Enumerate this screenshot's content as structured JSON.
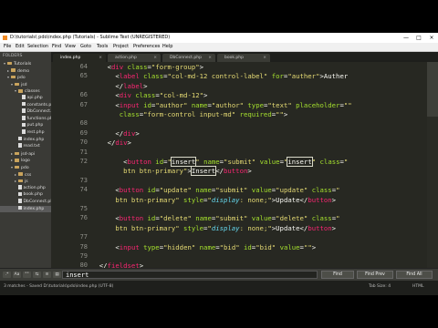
{
  "window": {
    "title": "D:\\tutorials\\ pdo\\index.php (Tutorials) - Sublime Text (UNREGISTERED)",
    "min_glyph": "—",
    "max_glyph": "□",
    "close_glyph": "×"
  },
  "menu": [
    "File",
    "Edit",
    "Selection",
    "Find",
    "View",
    "Goto",
    "Tools",
    "Project",
    "Preferences",
    "Help"
  ],
  "sidebar": {
    "header": "FOLDERS",
    "items": [
      {
        "label": "Tutorials",
        "kind": "folder",
        "twisty": "▾",
        "indent": 1
      },
      {
        "label": "demo",
        "kind": "folder",
        "twisty": "▸",
        "indent": 2
      },
      {
        "label": "pdo",
        "kind": "folder",
        "twisty": "▾",
        "indent": 2
      },
      {
        "label": "jsd",
        "kind": "folder",
        "twisty": "▾",
        "indent": 3
      },
      {
        "label": "classes",
        "kind": "folder",
        "twisty": "▾",
        "indent": 4
      },
      {
        "label": "api.php",
        "kind": "file",
        "twisty": "",
        "indent": 5
      },
      {
        "label": "constants.php",
        "kind": "file",
        "twisty": "",
        "indent": 5
      },
      {
        "label": "DbConnect.php",
        "kind": "file",
        "twisty": "",
        "indent": 5
      },
      {
        "label": "functions.php",
        "kind": "file",
        "twisty": "",
        "indent": 5
      },
      {
        "label": "put.php",
        "kind": "file",
        "twisty": "",
        "indent": 5
      },
      {
        "label": "rest.php",
        "kind": "file",
        "twisty": "",
        "indent": 5
      },
      {
        "label": "index.php",
        "kind": "file",
        "twisty": "",
        "indent": 4
      },
      {
        "label": "read.txt",
        "kind": "file",
        "twisty": "",
        "indent": 4
      },
      {
        "label": "jsd-api",
        "kind": "folder",
        "twisty": "▸",
        "indent": 3
      },
      {
        "label": "logo",
        "kind": "folder",
        "twisty": "▸",
        "indent": 3
      },
      {
        "label": "pdo",
        "kind": "folder",
        "twisty": "▾",
        "indent": 3
      },
      {
        "label": "css",
        "kind": "folder",
        "twisty": "▸",
        "indent": 4
      },
      {
        "label": "js",
        "kind": "folder",
        "twisty": "▸",
        "indent": 4
      },
      {
        "label": "action.php",
        "kind": "file",
        "twisty": "",
        "indent": 4
      },
      {
        "label": "book.php",
        "kind": "file",
        "twisty": "",
        "indent": 4
      },
      {
        "label": "DbConnect.php",
        "kind": "file",
        "twisty": "",
        "indent": 4
      },
      {
        "label": "index.php",
        "kind": "file",
        "twisty": "",
        "indent": 4,
        "selected": true
      }
    ]
  },
  "tabs": [
    {
      "label": "index.php",
      "active": true
    },
    {
      "label": "action.php",
      "active": false
    },
    {
      "label": "DbConnect.php",
      "active": false
    },
    {
      "label": "book.php",
      "active": false
    }
  ],
  "tab_close_glyph": "×",
  "editor": {
    "lines": [
      {
        "num": "64",
        "tokens": [
          [
            "pn",
            "    <"
          ],
          [
            "tg",
            "div"
          ],
          [
            "at",
            " class"
          ],
          [
            "pn",
            "="
          ],
          [
            "st",
            "\"form-group\""
          ],
          [
            "pn",
            ">"
          ]
        ]
      },
      {
        "num": "65",
        "tokens": [
          [
            "pn",
            "      <"
          ],
          [
            "tg",
            "label"
          ],
          [
            "at",
            " class"
          ],
          [
            "pn",
            "="
          ],
          [
            "st",
            "\"col-md-12 control-label\""
          ],
          [
            "at",
            " for"
          ],
          [
            "pn",
            "="
          ],
          [
            "st",
            "\"auther\""
          ],
          [
            "pn",
            ">"
          ],
          [
            "tx",
            "Auther"
          ]
        ]
      },
      {
        "num": "",
        "tokens": [
          [
            "pn",
            "      </"
          ],
          [
            "tg",
            "label"
          ],
          [
            "pn",
            ">"
          ]
        ]
      },
      {
        "num": "66",
        "tokens": [
          [
            "pn",
            "      <"
          ],
          [
            "tg",
            "div"
          ],
          [
            "at",
            " class"
          ],
          [
            "pn",
            "="
          ],
          [
            "st",
            "\"col-md-12\""
          ],
          [
            "pn",
            ">"
          ]
        ]
      },
      {
        "num": "67",
        "tokens": [
          [
            "pn",
            "      <"
          ],
          [
            "tg",
            "input"
          ],
          [
            "at",
            " id"
          ],
          [
            "pn",
            "="
          ],
          [
            "st",
            "\"author\""
          ],
          [
            "at",
            " name"
          ],
          [
            "pn",
            "="
          ],
          [
            "st",
            "\"author\""
          ],
          [
            "at",
            " type"
          ],
          [
            "pn",
            "="
          ],
          [
            "st",
            "\"text\""
          ],
          [
            "at",
            " placeholder"
          ],
          [
            "pn",
            "="
          ],
          [
            "st",
            "\"\""
          ]
        ]
      },
      {
        "num": "",
        "tokens": [
          [
            "at",
            "       class"
          ],
          [
            "pn",
            "="
          ],
          [
            "st",
            "\"form-control input-md\""
          ],
          [
            "at",
            " required"
          ],
          [
            "pn",
            "="
          ],
          [
            "st",
            "\"\""
          ],
          [
            "pn",
            ">"
          ]
        ]
      },
      {
        "num": "68",
        "tokens": [
          [
            "pn",
            ""
          ]
        ]
      },
      {
        "num": "69",
        "tokens": [
          [
            "pn",
            "      </"
          ],
          [
            "tg",
            "div"
          ],
          [
            "pn",
            ">"
          ]
        ]
      },
      {
        "num": "70",
        "tokens": [
          [
            "pn",
            "    </"
          ],
          [
            "tg",
            "div"
          ],
          [
            "pn",
            ">"
          ]
        ]
      },
      {
        "num": "71",
        "tokens": [
          [
            "pn",
            ""
          ]
        ]
      },
      {
        "num": "72",
        "tokens": [
          [
            "pn",
            "        <"
          ],
          [
            "tg",
            "button"
          ],
          [
            "at",
            " id"
          ],
          [
            "pn",
            "="
          ],
          [
            "st",
            "\""
          ],
          [
            "hl",
            "insert"
          ],
          [
            "st",
            "\""
          ],
          [
            "at",
            " name"
          ],
          [
            "pn",
            "="
          ],
          [
            "st",
            "\"submit\""
          ],
          [
            "at",
            " value"
          ],
          [
            "pn",
            "="
          ],
          [
            "st",
            "\""
          ],
          [
            "hl",
            "insert"
          ],
          [
            "st",
            "\""
          ],
          [
            "at",
            " class"
          ],
          [
            "pn",
            "="
          ],
          [
            "st",
            "\""
          ]
        ]
      },
      {
        "num": "",
        "tokens": [
          [
            "st",
            "        btn btn-primary\""
          ],
          [
            "pn",
            ">"
          ],
          [
            "hl",
            "Insert"
          ],
          [
            "pn",
            "</"
          ],
          [
            "tg",
            "button"
          ],
          [
            "pn",
            ">"
          ]
        ]
      },
      {
        "num": "73",
        "tokens": [
          [
            "pn",
            ""
          ]
        ]
      },
      {
        "num": "74",
        "tokens": [
          [
            "pn",
            "      <"
          ],
          [
            "tg",
            "button"
          ],
          [
            "at",
            " id"
          ],
          [
            "pn",
            "="
          ],
          [
            "st",
            "\"update\""
          ],
          [
            "at",
            " name"
          ],
          [
            "pn",
            "="
          ],
          [
            "st",
            "\"submit\""
          ],
          [
            "at",
            " value"
          ],
          [
            "pn",
            "="
          ],
          [
            "st",
            "\"update\""
          ],
          [
            "at",
            " class"
          ],
          [
            "pn",
            "="
          ],
          [
            "st",
            "\""
          ]
        ]
      },
      {
        "num": "",
        "tokens": [
          [
            "st",
            "      btn btn-primary\""
          ],
          [
            "at",
            " style"
          ],
          [
            "pn",
            "="
          ],
          [
            "st",
            "\""
          ],
          [
            "ki",
            "display"
          ],
          [
            "st",
            ": none;\""
          ],
          [
            "pn",
            ">"
          ],
          [
            "tx",
            "Update"
          ],
          [
            "pn",
            "</"
          ],
          [
            "tg",
            "button"
          ],
          [
            "pn",
            ">"
          ]
        ]
      },
      {
        "num": "75",
        "tokens": [
          [
            "pn",
            ""
          ]
        ]
      },
      {
        "num": "76",
        "tokens": [
          [
            "pn",
            "      <"
          ],
          [
            "tg",
            "button"
          ],
          [
            "at",
            " id"
          ],
          [
            "pn",
            "="
          ],
          [
            "st",
            "\"delete\""
          ],
          [
            "at",
            " name"
          ],
          [
            "pn",
            "="
          ],
          [
            "st",
            "\"submit\""
          ],
          [
            "at",
            " value"
          ],
          [
            "pn",
            "="
          ],
          [
            "st",
            "\"delete\""
          ],
          [
            "at",
            " class"
          ],
          [
            "pn",
            "="
          ],
          [
            "st",
            "\""
          ]
        ]
      },
      {
        "num": "",
        "tokens": [
          [
            "st",
            "      btn btn-primary\""
          ],
          [
            "at",
            " style"
          ],
          [
            "pn",
            "="
          ],
          [
            "st",
            "\""
          ],
          [
            "ki",
            "display"
          ],
          [
            "st",
            ": none;\""
          ],
          [
            "pn",
            ">"
          ],
          [
            "tx",
            "Update"
          ],
          [
            "pn",
            "</"
          ],
          [
            "tg",
            "button"
          ],
          [
            "pn",
            ">"
          ]
        ]
      },
      {
        "num": "77",
        "tokens": [
          [
            "pn",
            ""
          ]
        ]
      },
      {
        "num": "78",
        "tokens": [
          [
            "pn",
            "      <"
          ],
          [
            "tg",
            "input"
          ],
          [
            "at",
            " type"
          ],
          [
            "pn",
            "="
          ],
          [
            "st",
            "\"hidden\""
          ],
          [
            "at",
            " name"
          ],
          [
            "pn",
            "="
          ],
          [
            "st",
            "\"bid\""
          ],
          [
            "at",
            " id"
          ],
          [
            "pn",
            "="
          ],
          [
            "st",
            "\"bid\""
          ],
          [
            "at",
            " value"
          ],
          [
            "pn",
            "="
          ],
          [
            "st",
            "\"\""
          ],
          [
            "pn",
            ">"
          ]
        ]
      },
      {
        "num": "79",
        "tokens": [
          [
            "pn",
            ""
          ]
        ]
      },
      {
        "num": "80",
        "tokens": [
          [
            "pn",
            "  </"
          ],
          [
            "tg",
            "fieldset"
          ],
          [
            "pn",
            ">"
          ]
        ]
      }
    ]
  },
  "find": {
    "options": [
      ".*",
      "Aa",
      "\"\"",
      "⇆",
      "≡",
      "▤"
    ],
    "query": "insert",
    "buttons": [
      "Find",
      "Find Prev",
      "Find All"
    ]
  },
  "status": {
    "left": "3 matches - Saved D:\\tutorials\\pdo\\index.php (UTF-8)",
    "tab_size": "Tab Size: 4",
    "syntax": "HTML"
  }
}
